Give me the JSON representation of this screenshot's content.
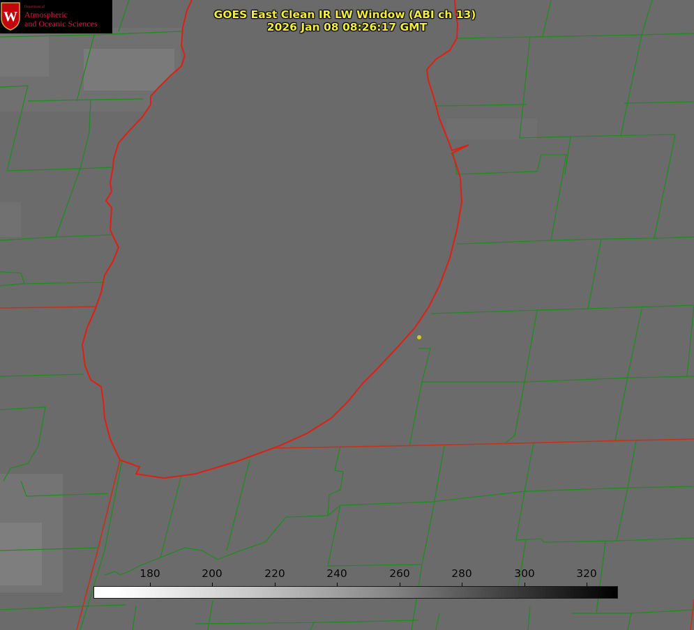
{
  "title": {
    "line1": "GOES East Clean IR LW Window (ABI ch 13)",
    "line2": "2026 Jan 08 08:26:17 GMT"
  },
  "logo": {
    "department": "Department of",
    "line1": "Atmospheric",
    "line2": "and Oceanic Sciences",
    "crest_letter": "W"
  },
  "colorbar": {
    "ticks": [
      "180",
      "200",
      "220",
      "240",
      "260",
      "280",
      "300",
      "320"
    ],
    "min": 162,
    "max": 330,
    "colormap": "grayscale, white (cold) to black (warm)"
  },
  "colors": {
    "county_lines": "#1c8c1c",
    "state_lines": "#e0261a",
    "lake_shore": "#e0261a",
    "title_text": "#f2ee3b",
    "station_marker": "#d6c81e",
    "background_gray": "#6b6b6b",
    "lake_gray": "#6a6a6a"
  }
}
